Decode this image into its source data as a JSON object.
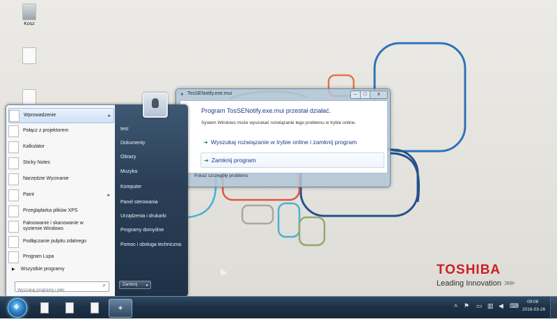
{
  "desktop": {
    "icons": [
      {
        "name": "recycle-bin",
        "label": "Kosz"
      },
      {
        "name": "file-1",
        "label": ""
      },
      {
        "name": "file-2",
        "label": ""
      }
    ]
  },
  "start_menu": {
    "programs": [
      {
        "label": "Wprowadzenie",
        "submenu": "▸"
      },
      {
        "label": "Połącz z projektorem",
        "submenu": ""
      },
      {
        "label": "Kalkulator",
        "submenu": ""
      },
      {
        "label": "Sticky Notes",
        "submenu": ""
      },
      {
        "label": "Narzędzie Wycinanie",
        "submenu": ""
      },
      {
        "label": "Paint",
        "submenu": "▸"
      },
      {
        "label": "Przeglądarka plików XPS",
        "submenu": ""
      },
      {
        "label": "Faksowanie i skanowanie w systemie Windows",
        "submenu": ""
      },
      {
        "label": "Podłączanie pulpitu zdalnego",
        "submenu": ""
      },
      {
        "label": "Program Lupa",
        "submenu": ""
      }
    ],
    "all_programs": "Wszystkie programy",
    "search_placeholder": "Wyszukaj programy i pliki",
    "right_items": [
      "test",
      "Dokumenty",
      "Obrazy",
      "Muzyka",
      "Komputer",
      "Panel sterowania",
      "Urządzenia i drukarki",
      "Programy domyślne",
      "Pomoc i obsługa techniczna"
    ],
    "shutdown_label": "Zamknij",
    "shutdown_caret": "▸"
  },
  "dialog": {
    "title": "TosSENotify.exe.mui",
    "heading": "Program TosSENotify.exe.mui przestał działać.",
    "description": "System Windows może wyszukać rozwiązanie tego problemu w trybie online.",
    "option_search": "Wyszukaj rozwiązanie w trybie online i zamknij program",
    "option_close": "Zamknij program",
    "details_link": "Pokaż szczegóły problemu",
    "btn_min": "–",
    "btn_max": "□",
    "btn_close": "x"
  },
  "branding": {
    "logo": "TOSHIBA",
    "tagline": "Leading Innovation",
    "tagline_chevrons": ">>>",
    "logo_color": "#cc1f24"
  },
  "taskbar": {
    "clock_time": "09:08",
    "clock_date": "2016-03-26",
    "tray_icons": [
      "chevron-up-icon",
      "flag-icon",
      "battery-icon",
      "network-icon",
      "volume-icon",
      "keyboard-icon"
    ]
  }
}
